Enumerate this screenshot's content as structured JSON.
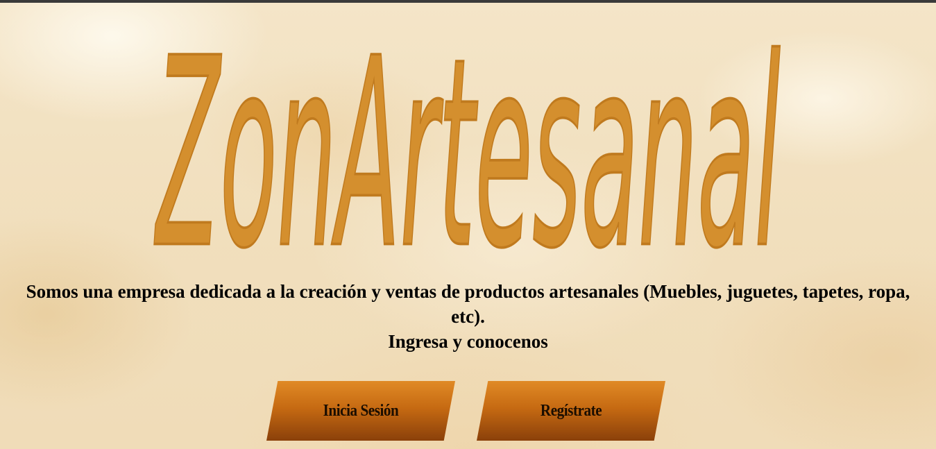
{
  "logo": {
    "text": "ZonArtesanal",
    "color": "#d48f2e"
  },
  "intro": {
    "line1": "Somos una empresa dedicada a la creación y ventas de productos artesanales (Muebles, juguetes, tapetes, ropa, etc).",
    "line2": "Ingresa y conocenos"
  },
  "buttons": {
    "login_label": "Inicia Sesión",
    "register_label": "Regístrate"
  },
  "colors": {
    "background": "#f3e3c4",
    "button_top": "#e08a26",
    "button_bottom": "#8a400a",
    "text": "#000000"
  }
}
